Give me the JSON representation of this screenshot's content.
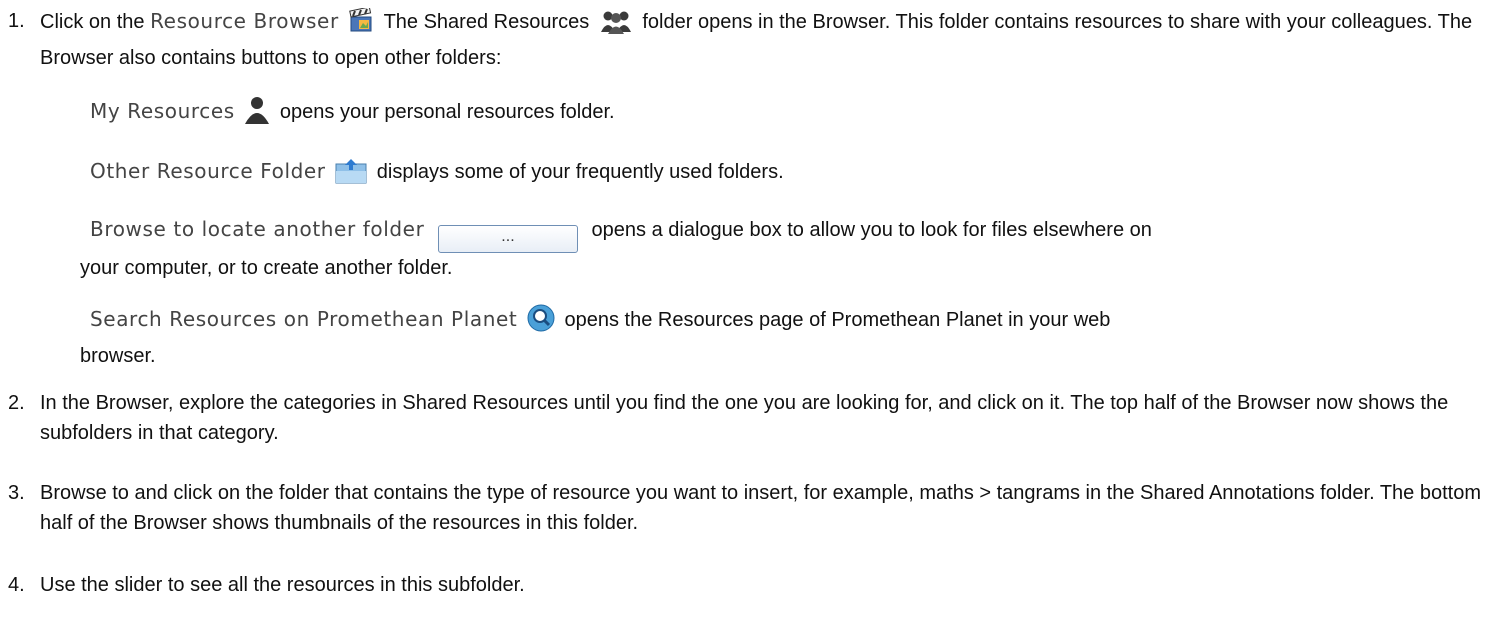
{
  "steps": [
    {
      "number": "1.",
      "a": "Click on the",
      "term": "Resource Browser",
      "b": "The Shared Resources",
      "c": "folder opens in the Browser. This folder contains resources to share with your colleagues. The Browser also contains buttons to open other folders:"
    },
    {
      "number": "2.",
      "text": "In the Browser, explore the categories in Shared Resources until you find the one you are looking for, and click on it. The top half of the Browser now shows the subfolders in that category."
    },
    {
      "number": "3.",
      "text": "Browse to and click on the folder that contains the type of resource you want to insert, for example, maths > tangrams in the Shared Annotations folder. The bottom half of the Browser shows thumbnails of the resources in this folder."
    },
    {
      "number": "4.",
      "text": "Use the slider to see all the resources in this subfolder."
    }
  ],
  "subitems": {
    "my_resources": {
      "term": "My Resources",
      "text": "opens your personal resources folder."
    },
    "other_folder": {
      "term": "Other Resource Folder",
      "text": "displays some of your frequently used folders."
    },
    "browse": {
      "term": "Browse to locate another folder",
      "button_label": "...",
      "text": "opens a dialogue box to allow you to look for files elsewhere on",
      "cont": "your computer,  or to create another folder."
    },
    "search": {
      "term": "Search Resources on Promethean Planet",
      "text": "opens the Resources page of Promethean Planet in your web",
      "cont": "browser."
    }
  },
  "icons": {
    "resource_browser": "clapperboard-icon",
    "shared_resources": "people-group-icon",
    "my_resources": "person-icon",
    "other_folder": "folder-upload-icon",
    "search": "magnifier-globe-icon"
  }
}
